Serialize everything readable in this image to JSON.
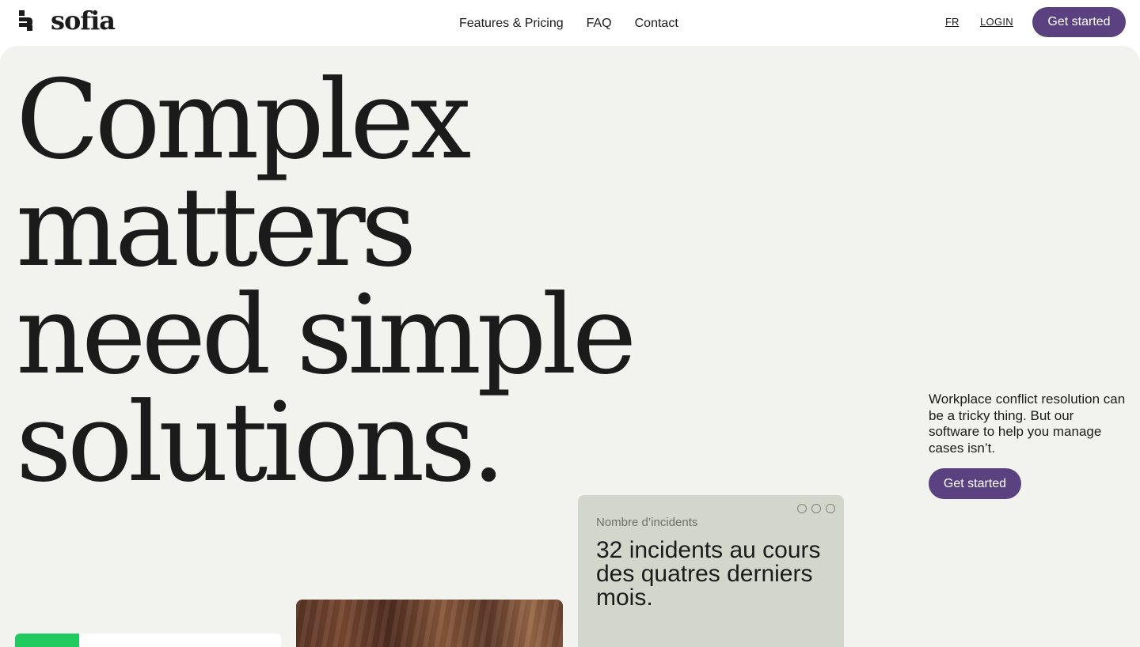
{
  "header": {
    "logo_text": "sofia",
    "nav": [
      {
        "label": "Features & Pricing"
      },
      {
        "label": "FAQ"
      },
      {
        "label": "Contact"
      }
    ],
    "lang_label": "FR",
    "login_label": "LOGIN",
    "cta_label": "Get started"
  },
  "hero": {
    "headline_lines": [
      "Complex matters",
      "need simple",
      "solutions."
    ],
    "side_text": "Workplace conflict resolution can be a tricky thing. But our software to help you manage cases isn’t.",
    "cta_label": "Get started"
  },
  "stat_card": {
    "label": "Nombre d’incidents",
    "value": "32 incidents au cours des quatres derniers mois."
  },
  "progress_card": {
    "progress_fraction": 0.24
  },
  "colors": {
    "brand_purple": "#5a4281",
    "hero_bg": "#f2f2ee",
    "card_green_gray": "#d3d7cb",
    "accent_green": "#1fcb5e"
  },
  "icons": {
    "logo_mark": "sofia-logo-icon",
    "window_dots": "window-dots-icon"
  }
}
